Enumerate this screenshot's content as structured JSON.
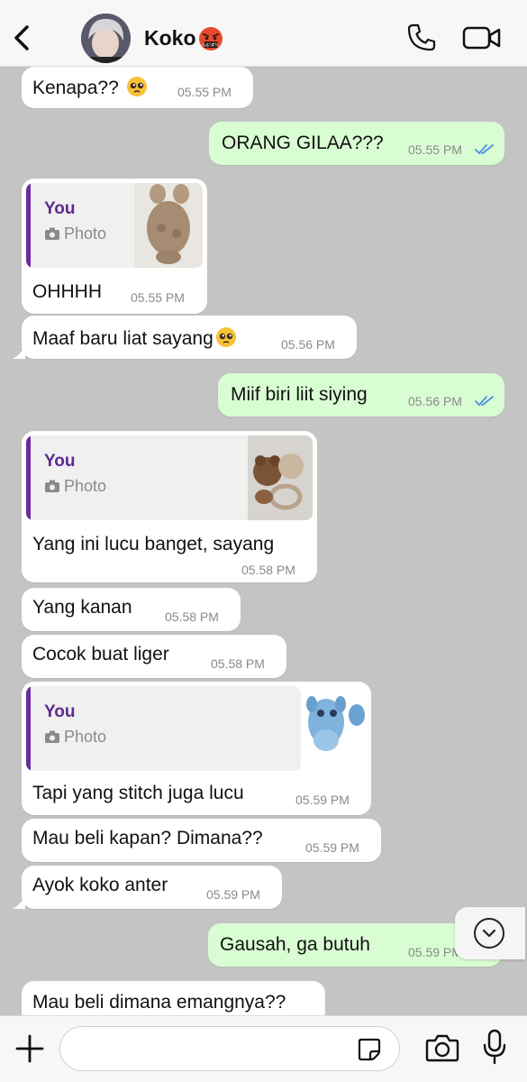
{
  "header": {
    "contact_name": "Koko",
    "status_emoji_icon": "face-with-symbols-on-mouth-icon",
    "icons": {
      "back": "chevron-left-icon",
      "call": "phone-icon",
      "video": "video-camera-icon"
    }
  },
  "messages": [
    {
      "direction": "in",
      "text": "Kenapa?? ",
      "emoji": "pleading-face-icon",
      "time": "05.55 PM"
    },
    {
      "direction": "out",
      "text": "ORANG GILAA???",
      "time": "05.55 PM",
      "read": true
    },
    {
      "direction": "in",
      "quote": {
        "author": "You",
        "type": "Photo"
      },
      "text": "OHHHH",
      "time": "05.55 PM"
    },
    {
      "direction": "in",
      "text": "Maaf baru liat sayang",
      "emoji": "pleading-face-icon",
      "time": "05.56 PM"
    },
    {
      "direction": "out",
      "text": "Miif biri liit siying",
      "time": "05.56 PM",
      "read": true
    },
    {
      "direction": "in",
      "quote": {
        "author": "You",
        "type": "Photo"
      },
      "text": "Yang ini lucu banget, sayang",
      "time": "05.58 PM"
    },
    {
      "direction": "in",
      "text": "Yang kanan",
      "time": "05.58 PM"
    },
    {
      "direction": "in",
      "text": "Cocok buat liger",
      "time": "05.58 PM"
    },
    {
      "direction": "in",
      "quote": {
        "author": "You",
        "type": "Photo"
      },
      "text": "Tapi yang stitch juga lucu",
      "time": "05.59 PM"
    },
    {
      "direction": "in",
      "text": "Mau beli kapan? Dimana??",
      "time": "05.59 PM"
    },
    {
      "direction": "in",
      "text": "Ayok koko anter",
      "time": "05.59 PM"
    },
    {
      "direction": "out",
      "text": "Gausah, ga butuh",
      "time": "05.59 PM"
    },
    {
      "direction": "in",
      "text": "Mau beli dimana emangnya??",
      "time": ""
    }
  ],
  "composer": {
    "placeholder": "",
    "icons": {
      "plus": "plus-icon",
      "sticker": "sticker-icon",
      "camera": "camera-icon",
      "mic": "microphone-icon"
    }
  },
  "colors": {
    "chat_bg": "#c4c4c4",
    "incoming": "#ffffff",
    "outgoing": "#d9fdd3",
    "quote_author": "#5e2a91",
    "read_ticks": "#4a90e2"
  }
}
